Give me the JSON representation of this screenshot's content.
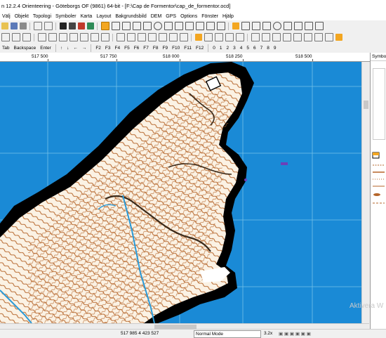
{
  "window": {
    "title": "n 12.2.4  Orienteering - Göteborgs OF (9861) 64-bit - [F:\\Cap de Formentor\\cap_de_formentor.ocd]"
  },
  "menu": [
    "Välj",
    "Objekt",
    "Topologi",
    "Symboler",
    "Karta",
    "Layout",
    "Bakgrundsbild",
    "DEM",
    "GPS",
    "Options",
    "Fönster",
    "Hjälp"
  ],
  "keys_toolbar": [
    "Tab",
    "Backspace",
    "Enter",
    "↑",
    "↓",
    "←",
    "→",
    "F2",
    "F3",
    "F4",
    "F5",
    "F6",
    "F7",
    "F8",
    "F9",
    "F10",
    "F11",
    "F12",
    "0",
    "1",
    "2",
    "3",
    "4",
    "5",
    "6",
    "7",
    "8",
    "9"
  ],
  "ruler": {
    "labels": [
      "517 500",
      "517 750",
      "518 000",
      "518 250",
      "518 500"
    ]
  },
  "panel": {
    "header": "Symbo"
  },
  "status": {
    "coordinates": "517 985    4 423 527",
    "mode": "Normal Mode",
    "zoom": "3.2x"
  },
  "watermark": "Aktivera W",
  "colors": {
    "water": "#1a8ad6",
    "land": "#fbf2e4",
    "contour": "#b5652a",
    "grid": "#74c2e8",
    "cliff": "#000000",
    "path": "#2a9ad8"
  },
  "icons": [
    "open-folder-icon",
    "save-icon",
    "print-icon",
    "undo-icon",
    "redo-icon",
    "select-arrow-icon",
    "zoom-icon",
    "pan-icon",
    "draw-curve-icon",
    "draw-rectangle-icon",
    "draw-circle-icon",
    "measure-icon",
    "grid-icon"
  ]
}
